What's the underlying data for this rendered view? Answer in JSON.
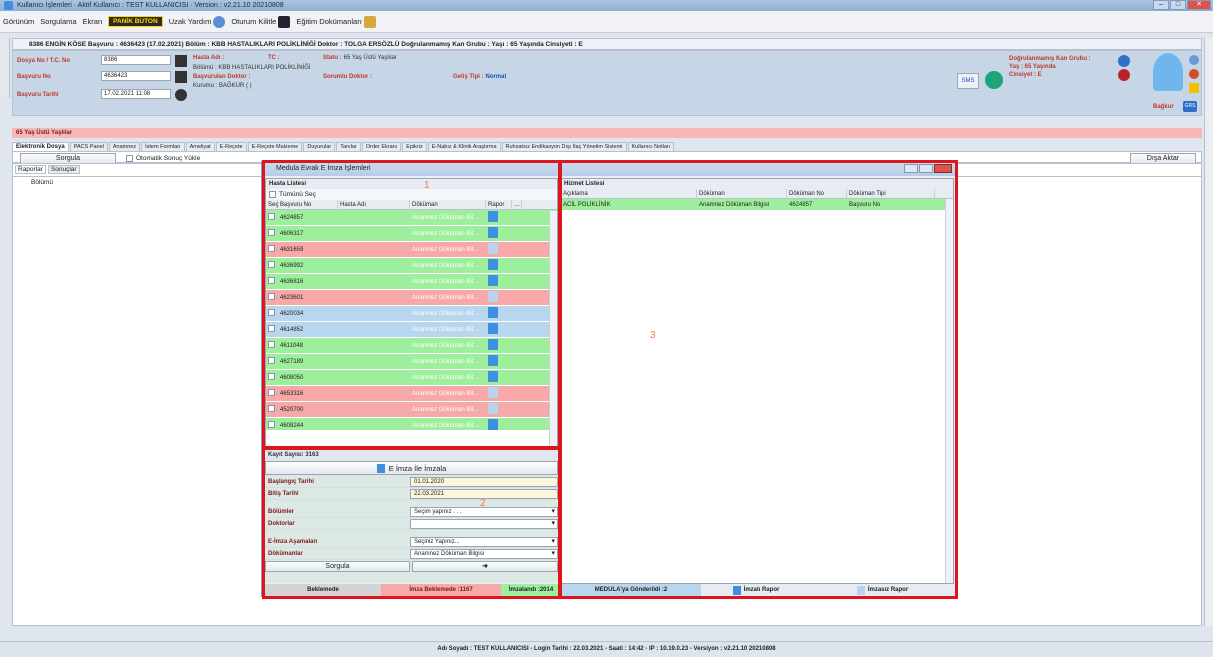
{
  "window": {
    "title": "Kullanıcı İşlemleri · Aktif Kullanıcı : TEST KULLANICISI · Version : v2.21.10 20210808"
  },
  "menu": {
    "items": [
      "Görünüm",
      "Sorgulama",
      "Ekran"
    ],
    "panic_button": "PANİK BUTON",
    "remote_help": "Uzak Yardım",
    "lock_session": "Oturum Kilitle",
    "training_docs": "Eğitim Dokümanları"
  },
  "patient": {
    "header": "8386 ENGİN KÖSE Başvuru : 4636423 (17.02.2021) Bölüm : KBB HASTALIKLARI POLİKLİNİĞİ Doktor : TOLGA ERSÖZLÜ Doğrulanmamış Kan Grubu : Yaşı : 65 Yaşında Cinsiyeti : E",
    "file_label": "Dosya No / T.C. No",
    "file_no": "8386",
    "app_label": "Başvuru No",
    "app_no": "4636423",
    "date_label": "Başvuru Tarihi",
    "date": "17.02.2021 11:08",
    "name_label": "Hasta Adı :",
    "tc_label": "TC :",
    "status_label": "Statu :",
    "status_val": "65 Yaş Üstü Yaşlılar",
    "dept_line": "Bölümü : KBB HASTALIKLARI POLİKLİNİĞİ",
    "referring_label": "Başvurulan Doktor :",
    "resp_label": "Sorumlu Doktor :",
    "arrival_label": "Geliş Tipi :",
    "arrival_val": "Normal",
    "institution": "Kurumu : BAĞKUR ( )",
    "blood_label": "Doğrulanmamış Kan Grubu :",
    "age_label": "Yaş : 65 Yaşında",
    "gender_label": "Cinsiyet : E",
    "sms": "SMS",
    "warning_bar": "65 Yaş Üstü Yaşlılar",
    "insurer": "Bağkur",
    "grs": "GRS"
  },
  "tabs": [
    "Elektronik Dosya",
    "PACS Panel",
    "Anamnez",
    "İstem Formları",
    "Ameliyat",
    "E-Reçete",
    "E-Reçete Malzeme",
    "Duyurular",
    "Tanılar",
    "Order Ekranı",
    "Epikriz",
    "E-Nabız & Klinik Araştırma",
    "Ruhsatsız Endikasyon Dışı İlaç Yönetim Sistemi",
    "Kullanıcı Notları"
  ],
  "toolbar": {
    "query": "Sorgula",
    "auto_load": "Otomatik Sonuç Yükle",
    "export": "Dışa Aktar",
    "sub_tabs": [
      "Raporlar",
      "Sonuçlar"
    ],
    "left_header": "Bölümü"
  },
  "dialog": {
    "title": "Medula Evrak E İmza İşlemleri",
    "patient_list": "Hasta Listesi",
    "select_all": "Tümünü Seç",
    "columns": [
      "Seç",
      "Başvuru No",
      "Hasta Adı",
      "Döküman",
      "Rapor"
    ],
    "rows": [
      {
        "no": "4624857",
        "doc": "Anamnez Döküman Bil...",
        "color": "green",
        "faint": false
      },
      {
        "no": "4606317",
        "doc": "Anamnez Döküman Bil...",
        "color": "green",
        "faint": false
      },
      {
        "no": "4631659",
        "doc": "Anamnez Döküman Bil...",
        "color": "red",
        "faint": true
      },
      {
        "no": "4636992",
        "doc": "Anamnez Döküman Bil...",
        "color": "green",
        "faint": false
      },
      {
        "no": "4636816",
        "doc": "Anamnez Döküman Bil...",
        "color": "green",
        "faint": false
      },
      {
        "no": "4623601",
        "doc": "Anamnez Döküman Bil...",
        "color": "red",
        "faint": true
      },
      {
        "no": "4620034",
        "doc": "Anamnez Döküman Bil...",
        "color": "blue",
        "faint": false
      },
      {
        "no": "4614852",
        "doc": "Anamnez Döküman Bil...",
        "color": "blue",
        "faint": false
      },
      {
        "no": "4611048",
        "doc": "Anamnez Döküman Bil...",
        "color": "green",
        "faint": false
      },
      {
        "no": "4627189",
        "doc": "Anamnez Döküman Bil...",
        "color": "green",
        "faint": false
      },
      {
        "no": "4608050",
        "doc": "Anamnez Döküman Bil...",
        "color": "green",
        "faint": false
      },
      {
        "no": "4653316",
        "doc": "Anamnez Döküman Bil...",
        "color": "red",
        "faint": true
      },
      {
        "no": "4520700",
        "doc": "Anamnez Döküman Bil...",
        "color": "red",
        "faint": true
      },
      {
        "no": "4608244",
        "doc": "Anamnez Döküman Bil...",
        "color": "green",
        "faint": false
      }
    ],
    "record_count": "Kayıt Sayısı: 3163",
    "sign_button": "E İmza İle İmzala",
    "start_label": "Başlangıç Tarihi",
    "start_val": "01.01.2020",
    "end_label": "Bitiş Tarihi",
    "end_val": "22.03.2021",
    "dept_label": "Bölümler",
    "dept_val": "Seçim yapınız . . .",
    "doctor_label": "Doktorlar",
    "stage_label": "E-İmza Aşamaları",
    "stage_val": "Seçiniz Yapınız...",
    "docs_label": "Dökümanlar",
    "docs_val": "Anamnez Döküman Bilgisi",
    "query": "Sorgula",
    "service_list": "Hizmet Listesi",
    "service_cols": [
      "Açıklama",
      "Döküman",
      "Döküman No",
      "Döküman Tipi"
    ],
    "service_row": [
      "ACİL POLİKLİNİK",
      "Anamnez Döküman Bilgisi",
      "4624857",
      "Başvuru No"
    ],
    "status": {
      "pending": "Beklemede",
      "sign_pending": "İmza Beklemede :1167",
      "signed": "İmzalandı :2014",
      "sent": "MEDULA'ya Gönderildi :2",
      "signed_report": "İmzalı Rapor",
      "unsigned_report": "İmzasız Rapor"
    },
    "markers": [
      "1",
      "2",
      "3"
    ]
  },
  "statusbar": "Adı Soyadı : TEST KULLANICISI  -  Login Tarihi : 22.03.2021  -  Saati : 14:42  -  IP : 10.19.0.23  -  Versiyon : v2.21.10 20210808",
  "colors": {
    "highlight": "#e0141e",
    "green": "#9dee9d",
    "red": "#f7a8a8",
    "blue": "#b8d6ee"
  }
}
